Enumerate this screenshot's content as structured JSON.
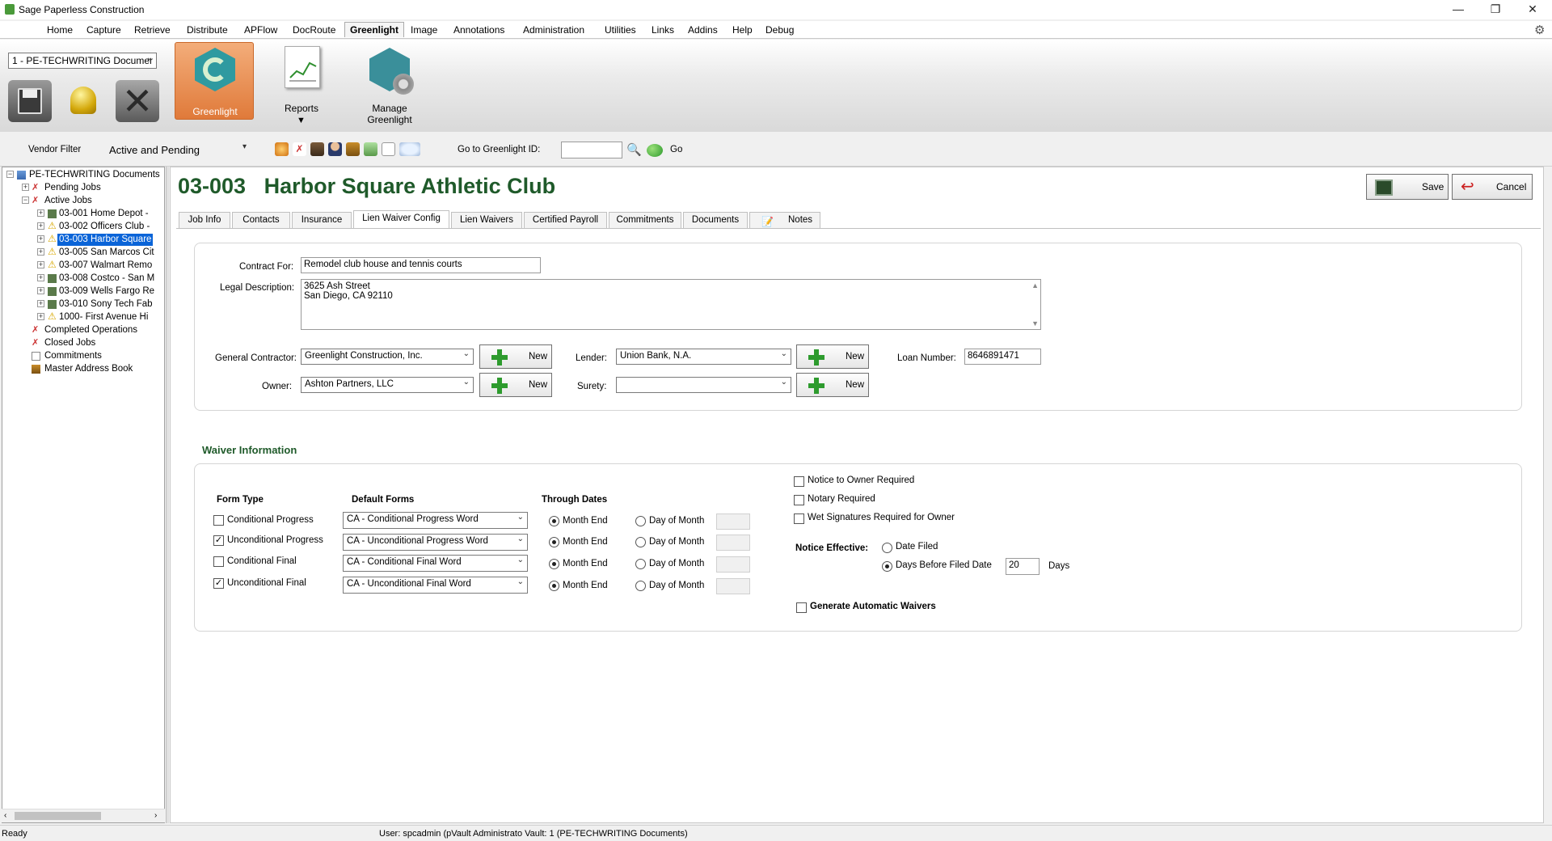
{
  "app": {
    "title": "Sage Paperless Construction"
  },
  "window_controls": {
    "minimize": "—",
    "restore": "❐",
    "close": "✕"
  },
  "menu": [
    "Home",
    "Capture",
    "Retrieve",
    "Distribute",
    "APFlow",
    "DocRoute",
    "Greenlight",
    "Image",
    "Annotations",
    "Administration",
    "Utilities",
    "Links",
    "Addins",
    "Help",
    "Debug"
  ],
  "menu_active": "Greenlight",
  "ribbon": {
    "vault_select": "1 - PE-TECHWRITING Documer",
    "greenlight_label": "Greenlight",
    "reports_label": "Reports",
    "manage_label": "Manage Greenlight",
    "accent": "#e8935a"
  },
  "toolbar": {
    "vendor_filter_label": "Vendor Filter",
    "vendor_filter_value": "Active and Pending",
    "goto_label": "Go to Greenlight ID:",
    "goto_value": "",
    "go_label": "Go"
  },
  "tree": {
    "root": "PE-TECHWRITING Documents",
    "pending": "Pending Jobs",
    "active": "Active Jobs",
    "jobs": [
      {
        "label": "03-001  Home Depot -",
        "icon": "building-icon"
      },
      {
        "label": "03-002  Officers Club -",
        "icon": "warning-icon"
      },
      {
        "label": "03-003  Harbor Square",
        "icon": "warning-icon",
        "selected": true
      },
      {
        "label": "03-005  San Marcos Cit",
        "icon": "warning-icon"
      },
      {
        "label": "03-007  Walmart Remo",
        "icon": "warning-icon"
      },
      {
        "label": "03-008  Costco - San M",
        "icon": "building-icon"
      },
      {
        "label": "03-009  Wells Fargo Re",
        "icon": "building-icon"
      },
      {
        "label": "03-010  Sony Tech Fab",
        "icon": "building-icon"
      },
      {
        "label": "1000-  First  Avenue Hi",
        "icon": "warning-icon"
      }
    ],
    "completed": "Completed Operations",
    "closed": "Closed Jobs",
    "commitments": "Commitments",
    "address_book": "Master Address Book"
  },
  "job": {
    "number": "03-003",
    "name": "Harbor Square Athletic Club"
  },
  "actions": {
    "save": "Save",
    "cancel": "Cancel"
  },
  "tabs": [
    "Job Info",
    "Contacts",
    "Insurance",
    "Lien Waiver Config",
    "Lien Waivers",
    "Certified Payroll",
    "Commitments",
    "Documents",
    "Notes"
  ],
  "active_tab": "Lien Waiver Config",
  "contract": {
    "contract_for_label": "Contract For:",
    "contract_for": "Remodel club house and tennis courts",
    "legal_label": "Legal Description:",
    "legal_line1": "3625 Ash Street",
    "legal_line2": "San Diego, CA 92110",
    "gc_label": "General Contractor:",
    "gc": "Greenlight Construction, Inc.",
    "owner_label": "Owner:",
    "owner": "Ashton Partners, LLC",
    "lender_label": "Lender:",
    "lender": "Union Bank, N.A.",
    "surety_label": "Surety:",
    "surety": "",
    "loan_label": "Loan Number:",
    "loan": "8646891471",
    "new_label": "New"
  },
  "waiver": {
    "section_title": "Waiver Information",
    "form_type_hdr": "Form Type",
    "default_forms_hdr": "Default Forms",
    "through_dates_hdr": "Through Dates",
    "month_end": "Month End",
    "day_of_month": "Day of Month",
    "rows": [
      {
        "type": "Conditional Progress",
        "checked": false,
        "form": "CA - Conditional Progress Word"
      },
      {
        "type": "Unconditional Progress",
        "checked": true,
        "form": "CA - Unconditional Progress Word"
      },
      {
        "type": "Conditional Final",
        "checked": false,
        "form": "CA - Conditional Final Word"
      },
      {
        "type": "Unconditional Final",
        "checked": true,
        "form": "CA - Unconditional Final Word"
      }
    ],
    "notice_owner": "Notice to Owner Required",
    "notary": "Notary Required",
    "wet_sig": "Wet Signatures Required for Owner",
    "notice_effective": "Notice Effective:",
    "date_filed": "Date Filed",
    "days_before": "Days Before Filed Date",
    "days_value": "20",
    "days_label": "Days",
    "auto_waivers": "Generate Automatic Waivers"
  },
  "status": {
    "ready": "Ready",
    "info": "User: spcadmin (pVault Administrato Vault: 1 (PE-TECHWRITING Documents)"
  }
}
